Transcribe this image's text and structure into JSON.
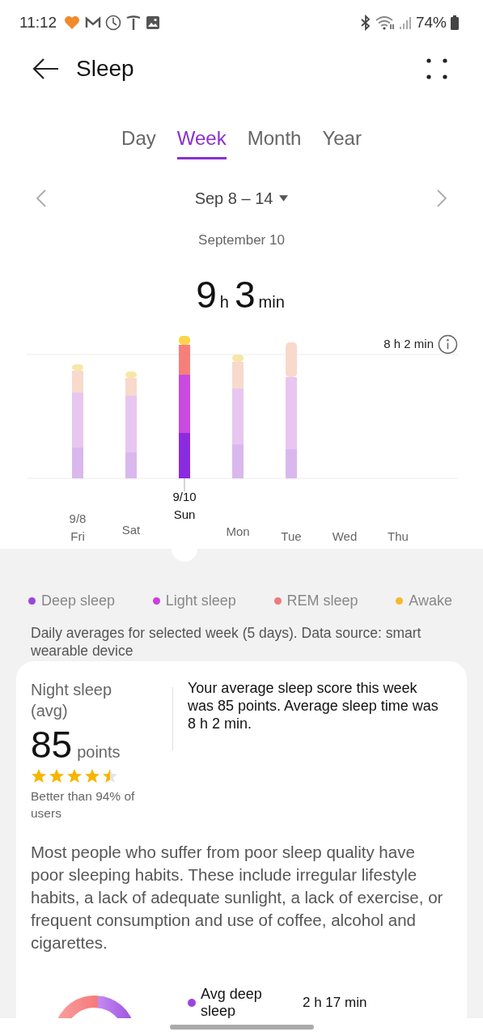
{
  "status_bar": {
    "time": "11:12",
    "battery": "74%"
  },
  "header": {
    "title": "Sleep"
  },
  "tabs": [
    {
      "label": "Day",
      "selected": false
    },
    {
      "label": "Week",
      "selected": true
    },
    {
      "label": "Month",
      "selected": false
    },
    {
      "label": "Year",
      "selected": false
    }
  ],
  "date_range": {
    "label": "Sep 8 – 14"
  },
  "selected_date": "September 10",
  "total": {
    "hours": "9",
    "hours_unit": "h",
    "minutes": "3",
    "minutes_unit": "min"
  },
  "chart": {
    "reference_label": "8 h 2 min",
    "days": [
      {
        "date": "9/8",
        "day": "Fri",
        "selected": false
      },
      {
        "day": "Sat",
        "selected": false
      },
      {
        "date": "9/10",
        "day": "Sun",
        "selected": true
      },
      {
        "day": "Mon",
        "selected": false
      },
      {
        "day": "Tue",
        "selected": false
      },
      {
        "day": "Wed",
        "selected": false
      },
      {
        "day": "Thu",
        "selected": false
      }
    ]
  },
  "legend": [
    {
      "label": "Deep sleep",
      "color": "#9b45e0"
    },
    {
      "label": "Light sleep",
      "color": "#c941d9"
    },
    {
      "label": "REM sleep",
      "color": "#f07a7a"
    },
    {
      "label": "Awake",
      "color": "#f5b82e"
    }
  ],
  "note": "Daily averages for selected week (5 days). Data source: smart wearable device",
  "summary": {
    "title": "Night sleep (avg)",
    "score": "85",
    "score_unit": "points",
    "stars": 4.5,
    "comparison": "Better than 94% of users",
    "description": "Your average sleep score this week was 85 points. Average sleep time was 8 h 2 min."
  },
  "tip": "Most people who suffer from poor sleep quality have poor sleeping habits. These include irregular lifestyle habits, a lack of adequate sunlight, a lack of exercise, or frequent consumption and use of coffee, alcohol and cigarettes.",
  "breakdown": [
    {
      "label": "Avg deep sleep",
      "value": "2 h 17 min",
      "color": "#9b45e0"
    }
  ]
}
